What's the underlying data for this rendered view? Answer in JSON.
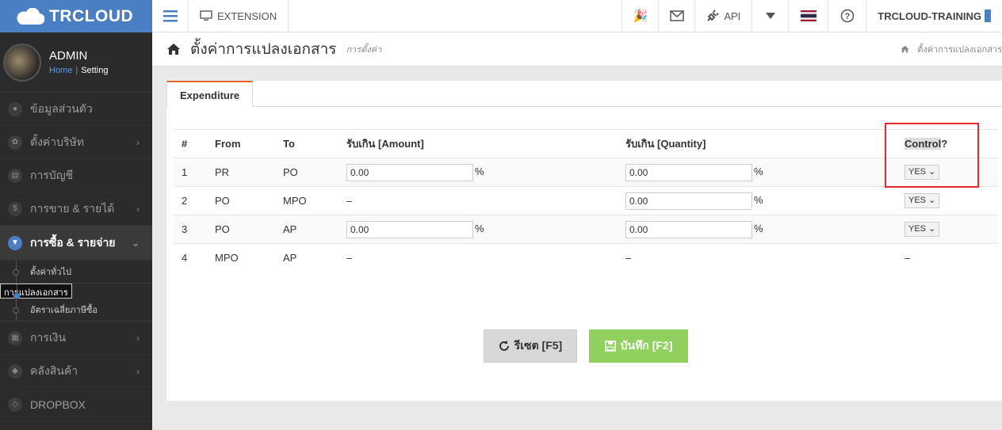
{
  "brand": {
    "name": "TRCLOUD"
  },
  "profile": {
    "name": "ADMIN",
    "crumb_home": "Home",
    "crumb_sep": "|",
    "crumb_current": "Setting"
  },
  "sidebar": {
    "items": [
      {
        "label": "ข้อมูลส่วนตัว",
        "icon": "user-icon"
      },
      {
        "label": "ตั้งค่าบริษัท",
        "icon": "gear-icon"
      },
      {
        "label": "การบัญชี",
        "icon": "book-icon"
      },
      {
        "label": "การขาย & รายได้",
        "icon": "dollar-icon"
      },
      {
        "label": "การซื้อ & รายจ่าย",
        "icon": "cart-icon"
      },
      {
        "label": "การเงิน",
        "icon": "calendar-icon"
      },
      {
        "label": "คลังสินค้า",
        "icon": "box-icon"
      },
      {
        "label": "DROPBOX",
        "icon": "dropbox-icon"
      }
    ],
    "subitems": [
      {
        "label": "ตั้งค่าทั่วไป"
      },
      {
        "label": "การแปลงเอกสาร"
      },
      {
        "label": "อัตราเฉลี่ยภาษีซื้อ"
      }
    ]
  },
  "topbar": {
    "extension": "EXTENSION",
    "api": "API",
    "user": "TRCLOUD-TRAINING"
  },
  "page": {
    "title": "ตั้งค่าการแปลงเอกสาร",
    "subtitle": "การตั้งค่า",
    "breadcrumb": "ตั้งค่าการแปลงเอกสาร"
  },
  "tab": {
    "label": "Expenditure"
  },
  "table": {
    "headers": {
      "num": "#",
      "from": "From",
      "to": "To",
      "amount": "รับเกิน [Amount]",
      "quantity": "รับเกิน [Quantity]",
      "control_a": "Control",
      "control_b": "?"
    },
    "rows": [
      {
        "num": "1",
        "from": "PR",
        "to": "PO",
        "amount": "0.00",
        "amount_unit": "%",
        "quantity": "0.00",
        "quantity_unit": "%",
        "control": "YES"
      },
      {
        "num": "2",
        "from": "PO",
        "to": "MPO",
        "amount": "–",
        "quantity": "0.00",
        "quantity_unit": "%",
        "control": "YES"
      },
      {
        "num": "3",
        "from": "PO",
        "to": "AP",
        "amount": "0.00",
        "amount_unit": "%",
        "quantity": "0.00",
        "quantity_unit": "%",
        "control": "YES"
      },
      {
        "num": "4",
        "from": "MPO",
        "to": "AP",
        "amount": "–",
        "quantity": "–",
        "control": "–"
      }
    ]
  },
  "buttons": {
    "reset": "รีเซต [F5]",
    "save": "บันทึก [F2]"
  },
  "colors": {
    "brand": "#4a7fc4",
    "tab_accent": "#e0652b",
    "save": "#8fd05e",
    "highlight_box": "#e8262e"
  }
}
